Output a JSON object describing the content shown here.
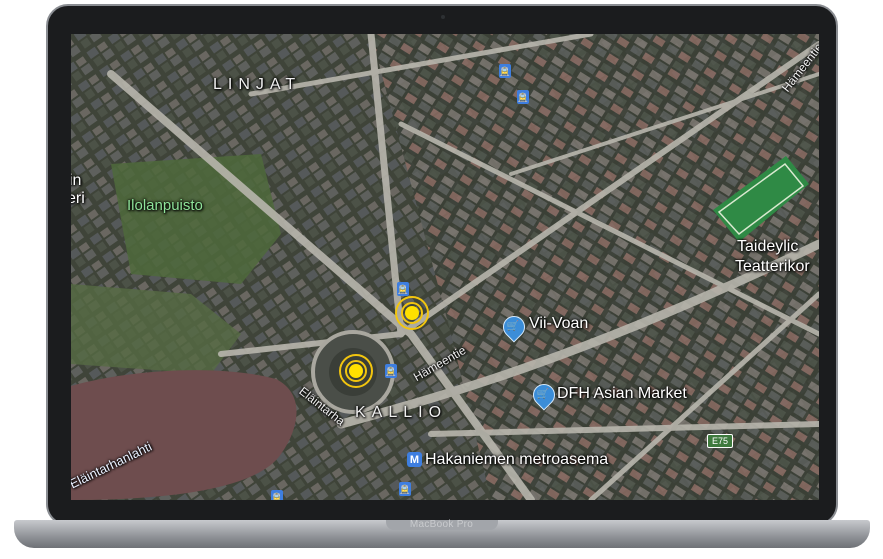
{
  "device": {
    "brand_label": "MacBook Pro"
  },
  "map": {
    "type": "satellite",
    "district_labels": [
      "LINJAT",
      "KALLIO"
    ],
    "park_labels": [
      "Ilolanpuisto"
    ],
    "places": [
      {
        "name": "Vii-Voan",
        "icon": "shopping-cart-icon"
      },
      {
        "name": "DFH Asian Market",
        "icon": "shopping-cart-icon"
      }
    ],
    "stations": [
      {
        "name": "Hakaniemen metroasema",
        "icon": "metro-icon",
        "glyph": "M"
      }
    ],
    "streets": [
      "Hämeentie",
      "Hämeentie",
      "Hämeentie",
      "Eläintarha"
    ],
    "water_labels": [
      "Eläintarhanlahti"
    ],
    "edge_labels": [
      "Taideylic",
      "Teatterikor",
      "in",
      "eri"
    ],
    "highway_shield": "E75",
    "tram_glyph": "🚊",
    "highlight_color": "#ffe000",
    "pin_color": "#3b8dd8"
  }
}
